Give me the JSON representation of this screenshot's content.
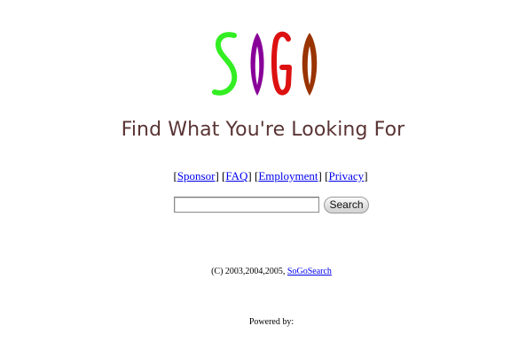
{
  "logo": {
    "text": "SOGO",
    "colors": {
      "S": "#33ee22",
      "O1": "#880099",
      "G": "#dd1111",
      "O2": "#993300"
    }
  },
  "tagline": "Find What You're Looking For",
  "nav": {
    "open": "[",
    "close": "]",
    "links": [
      {
        "label": "Sponsor"
      },
      {
        "label": "FAQ"
      },
      {
        "label": "Employment"
      },
      {
        "label": "Privacy"
      }
    ]
  },
  "search": {
    "value": "",
    "placeholder": "",
    "button_label": "Search"
  },
  "footer": {
    "copyright_prefix": "(C) 2003,2004,2005, ",
    "copyright_link": "SoGoSearch",
    "powered_by": "Powered by:"
  }
}
